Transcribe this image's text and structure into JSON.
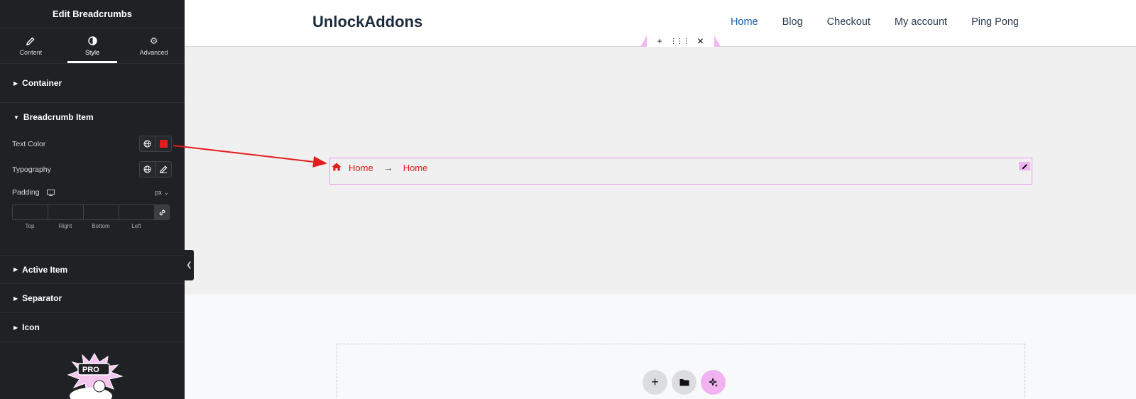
{
  "panel": {
    "title": "Edit Breadcrumbs",
    "tabs": [
      {
        "label": "Content",
        "icon": "pencil-icon"
      },
      {
        "label": "Style",
        "icon": "contrast-icon"
      },
      {
        "label": "Advanced",
        "icon": "gear-icon"
      }
    ],
    "active_tab": "Style",
    "sections": {
      "container": "Container",
      "breadcrumb_item": "Breadcrumb Item",
      "active_item": "Active Item",
      "separator": "Separator",
      "icon": "Icon"
    },
    "controls": {
      "text_color_label": "Text Color",
      "text_color_value": "#e41c1c",
      "typography_label": "Typography",
      "padding_label": "Padding",
      "padding_unit": "px",
      "dimension_labels": [
        "Top",
        "Right",
        "Bottom",
        "Left"
      ]
    },
    "pro_badge_text": "PRO"
  },
  "site": {
    "logo": "UnlockAddons",
    "nav": [
      "Home",
      "Blog",
      "Checkout",
      "My account",
      "Ping Pong"
    ],
    "current_nav": "Home"
  },
  "breadcrumbs": {
    "items": [
      "Home",
      "Home"
    ],
    "separator": "→",
    "color": "#e01e1e"
  },
  "annotation_color": "#e41c1c"
}
